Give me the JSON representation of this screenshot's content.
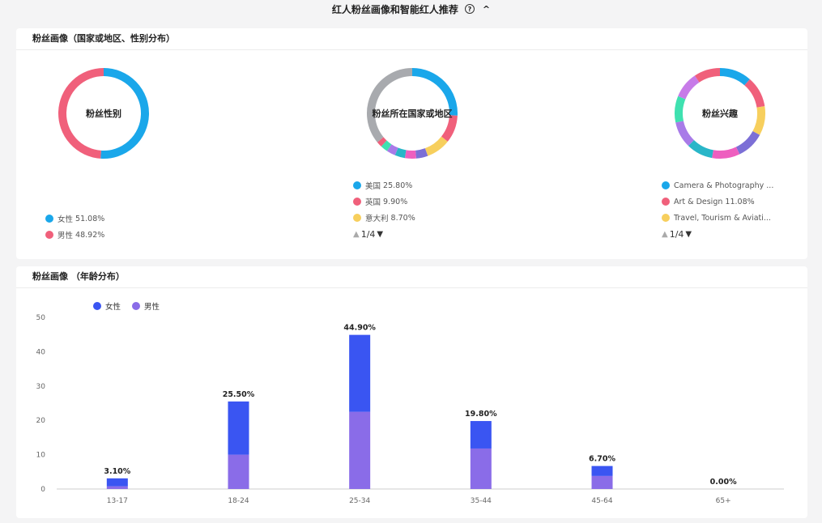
{
  "header": {
    "title": "红人粉丝画像和智能红人推荐",
    "help_icon": "?",
    "collapse_icon": "^"
  },
  "demographics": {
    "title": "粉丝画像（国家或地区、性别分布）",
    "gender": {
      "label": "粉丝性别",
      "slices": [
        {
          "name": "女性",
          "pct": "51.08%",
          "value": 51.08,
          "color": "#1aa7ea"
        },
        {
          "name": "男性",
          "pct": "48.92%",
          "value": 48.92,
          "color": "#f0607b"
        }
      ]
    },
    "country": {
      "label": "粉丝所在国家或地区",
      "legend": [
        {
          "name": "美国",
          "pct": "25.80%",
          "color": "#1aa7ea"
        },
        {
          "name": "英国",
          "pct": "9.90%",
          "color": "#f0607b"
        },
        {
          "name": "意大利",
          "pct": "8.70%",
          "color": "#f7cf5d"
        }
      ],
      "slices": [
        {
          "value": 25.8,
          "color": "#1aa7ea"
        },
        {
          "value": 9.9,
          "color": "#f0607b"
        },
        {
          "value": 8.7,
          "color": "#f7cf5d"
        },
        {
          "value": 4.2,
          "color": "#7c6fd6"
        },
        {
          "value": 4.0,
          "color": "#ee5fbf"
        },
        {
          "value": 3.6,
          "color": "#29b6c8"
        },
        {
          "value": 3.2,
          "color": "#a87be8"
        },
        {
          "value": 2.6,
          "color": "#3fe1b0"
        },
        {
          "value": 2.0,
          "color": "#f0607b"
        },
        {
          "value": 36.0,
          "color": "#a8aaae"
        }
      ],
      "pager": "1/4"
    },
    "interests": {
      "label": "粉丝兴趣",
      "legend": [
        {
          "name": "Camera & Photography ...",
          "pct": "",
          "color": "#1aa7ea"
        },
        {
          "name": "Art & Design",
          "pct": "11.08%",
          "color": "#f0607b"
        },
        {
          "name": "Travel, Tourism & Aviati...",
          "pct": "",
          "color": "#f7cf5d"
        }
      ],
      "slices": [
        {
          "value": 11.5,
          "color": "#1aa7ea"
        },
        {
          "value": 11.08,
          "color": "#f0607b"
        },
        {
          "value": 10.5,
          "color": "#f7cf5d"
        },
        {
          "value": 10.0,
          "color": "#7c6fd6"
        },
        {
          "value": 10.0,
          "color": "#ee5fbf"
        },
        {
          "value": 9.5,
          "color": "#29b6c8"
        },
        {
          "value": 9.5,
          "color": "#a87be8"
        },
        {
          "value": 9.5,
          "color": "#3fe1b0"
        },
        {
          "value": 9.5,
          "color": "#c77be8"
        },
        {
          "value": 9.4,
          "color": "#f0607b"
        }
      ],
      "pager": "1/4"
    }
  },
  "age": {
    "title": "粉丝画像 （年龄分布）",
    "legend": [
      {
        "name": "女性",
        "color": "#3a55f2"
      },
      {
        "name": "男性",
        "color": "#8a6ce8"
      }
    ]
  },
  "chart_data": {
    "type": "bar",
    "stacked": true,
    "categories": [
      "13-17",
      "18-24",
      "25-34",
      "35-44",
      "45-64",
      "65+"
    ],
    "labels": [
      "3.10%",
      "25.50%",
      "44.90%",
      "19.80%",
      "6.70%",
      "0.00%"
    ],
    "series": [
      {
        "name": "男性",
        "color": "#8a6ce8",
        "values": [
          0.8,
          10.0,
          22.5,
          11.8,
          3.8,
          0
        ]
      },
      {
        "name": "女性",
        "color": "#3a55f2",
        "values": [
          2.3,
          15.5,
          22.4,
          8.0,
          2.9,
          0
        ]
      }
    ],
    "ylim": [
      0,
      50
    ],
    "yticks": [
      0,
      10,
      20,
      30,
      40,
      50
    ],
    "grid": false,
    "legend": "top-left"
  }
}
